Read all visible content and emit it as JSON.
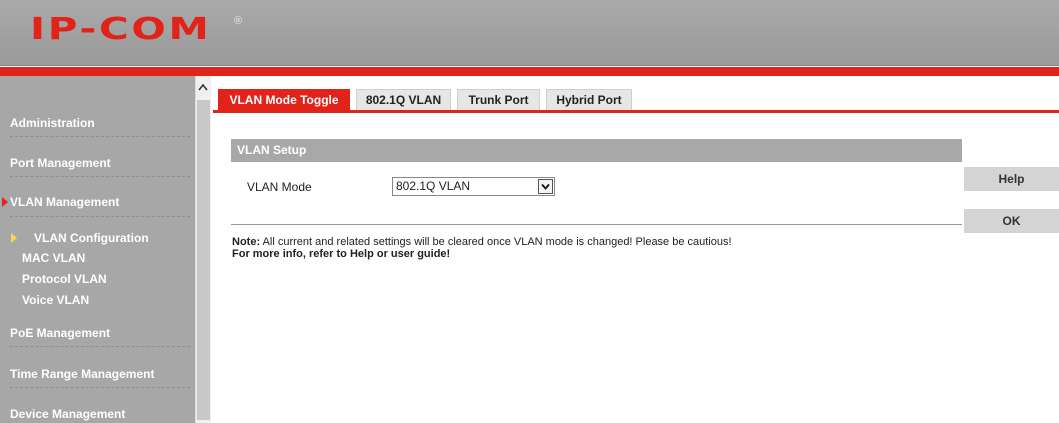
{
  "brand": {
    "logo": "IP-COM",
    "reg": "®"
  },
  "colors": {
    "accent": "#e2231a",
    "sidebar": "#a7a7a7",
    "section_bar": "#a8a8a8"
  },
  "sidebar": {
    "items": [
      {
        "label": "Administration"
      },
      {
        "label": "Port Management"
      },
      {
        "label": "VLAN Management",
        "active": true
      },
      {
        "label": "PoE Management"
      },
      {
        "label": "Time Range Management"
      },
      {
        "label": "Device Management"
      }
    ],
    "sub_items": [
      {
        "label": "VLAN Configuration",
        "active": true
      },
      {
        "label": "MAC VLAN"
      },
      {
        "label": "Protocol VLAN"
      },
      {
        "label": "Voice VLAN"
      }
    ]
  },
  "tabs": [
    {
      "label": "VLAN Mode Toggle",
      "active": true
    },
    {
      "label": "802.1Q VLAN"
    },
    {
      "label": "Trunk Port"
    },
    {
      "label": "Hybrid Port"
    }
  ],
  "section": {
    "title": "VLAN Setup"
  },
  "form": {
    "vlan_mode_label": "VLAN Mode",
    "vlan_mode_value": "802.1Q VLAN"
  },
  "note": {
    "prefix": "Note:",
    "text": " All current and related settings will be cleared once VLAN mode is changed! Please be cautious!",
    "more": "For more info, refer to Help or user guide!"
  },
  "buttons": {
    "help": "Help",
    "ok": "OK"
  },
  "icons": {
    "scroll_up": "chevron-up-icon",
    "dropdown": "chevron-down-icon",
    "active_marker": "caret-right-icon"
  }
}
